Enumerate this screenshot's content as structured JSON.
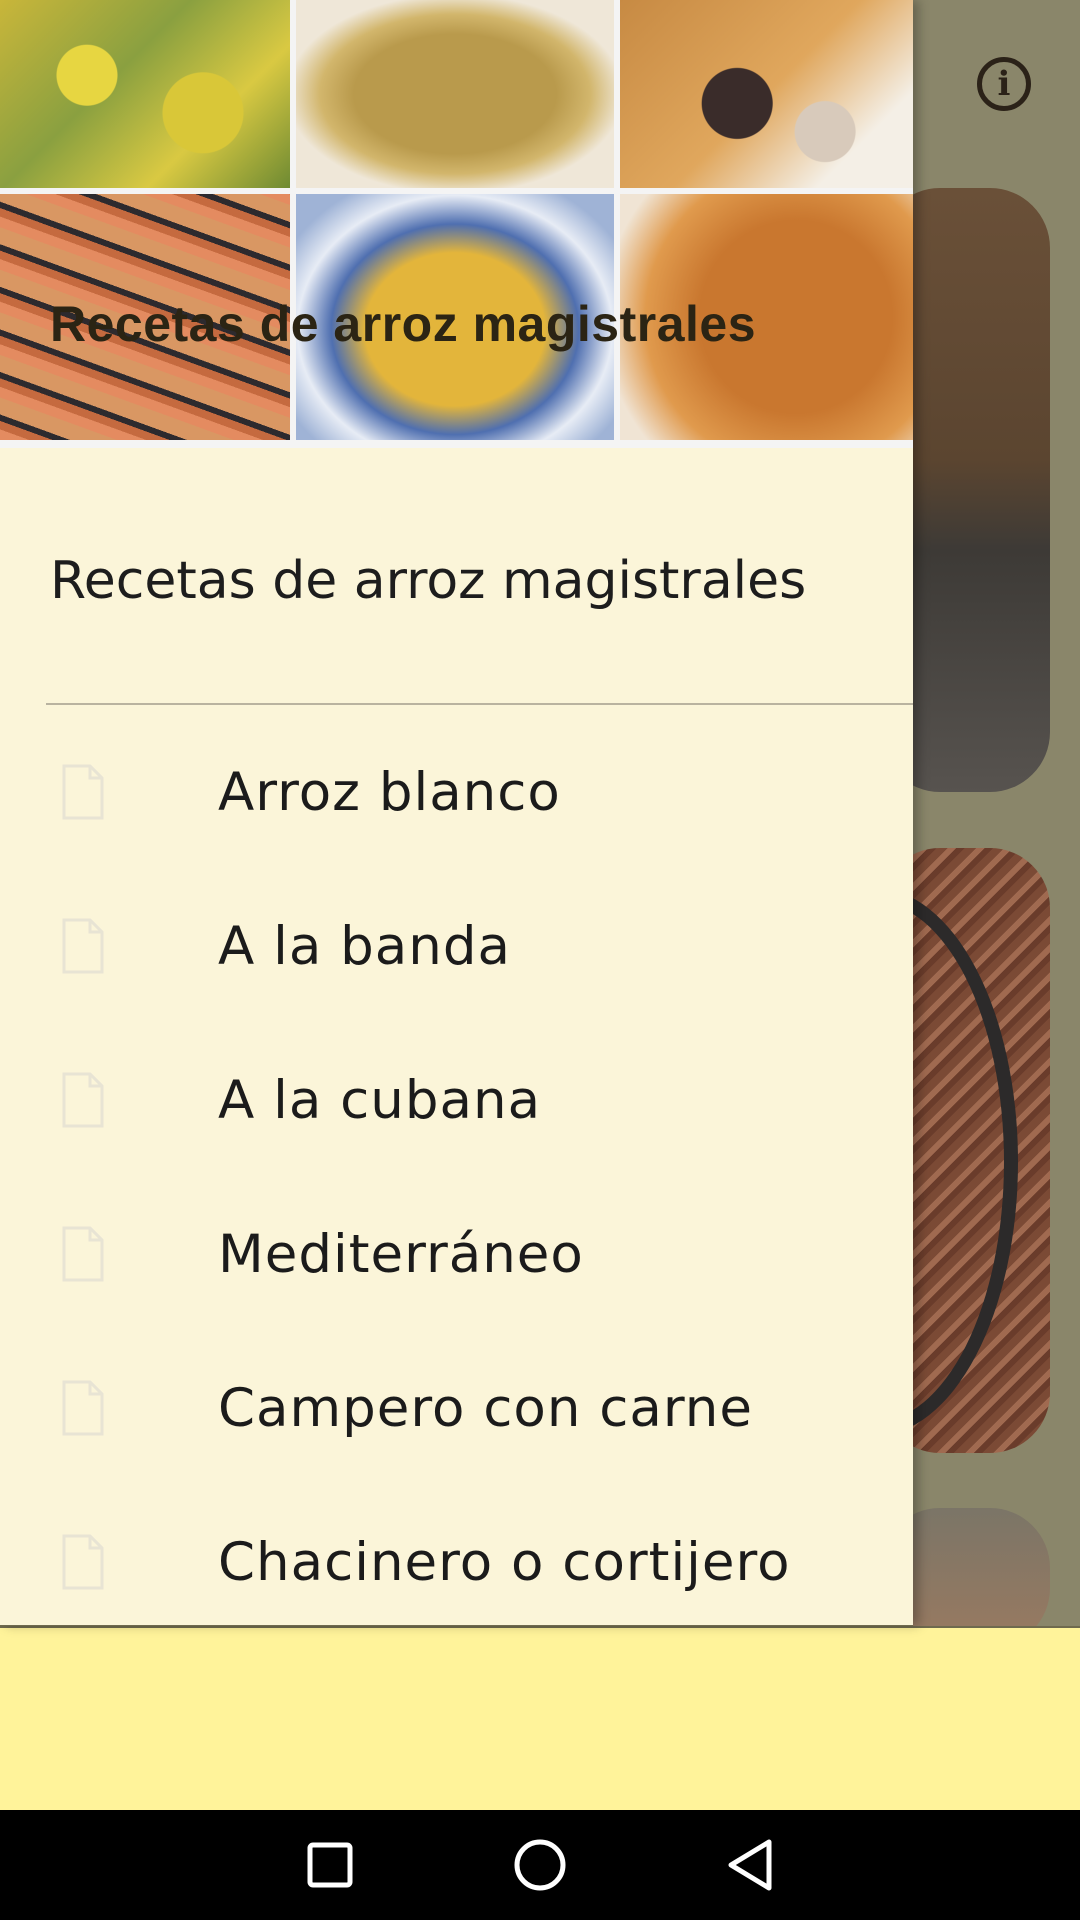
{
  "drawer": {
    "header_title": "Recetas de arroz magistrales",
    "subtitle": "Recetas de arroz magistrales",
    "items": [
      {
        "label": "Arroz blanco",
        "icon": "document-icon"
      },
      {
        "label": "A la banda",
        "icon": "document-icon"
      },
      {
        "label": "A la cubana",
        "icon": "document-icon"
      },
      {
        "label": "Mediterráneo",
        "icon": "document-icon"
      },
      {
        "label": "Campero con carne",
        "icon": "document-icon"
      },
      {
        "label": "Chacinero o cortijero",
        "icon": "document-icon"
      }
    ]
  },
  "app": {
    "info_icon": "info-icon",
    "info_glyph": "i"
  },
  "colors": {
    "drawer_bg": "#fbf5d9",
    "ad_banner_bg": "#fff39a",
    "nav_bar_bg": "#000000"
  }
}
